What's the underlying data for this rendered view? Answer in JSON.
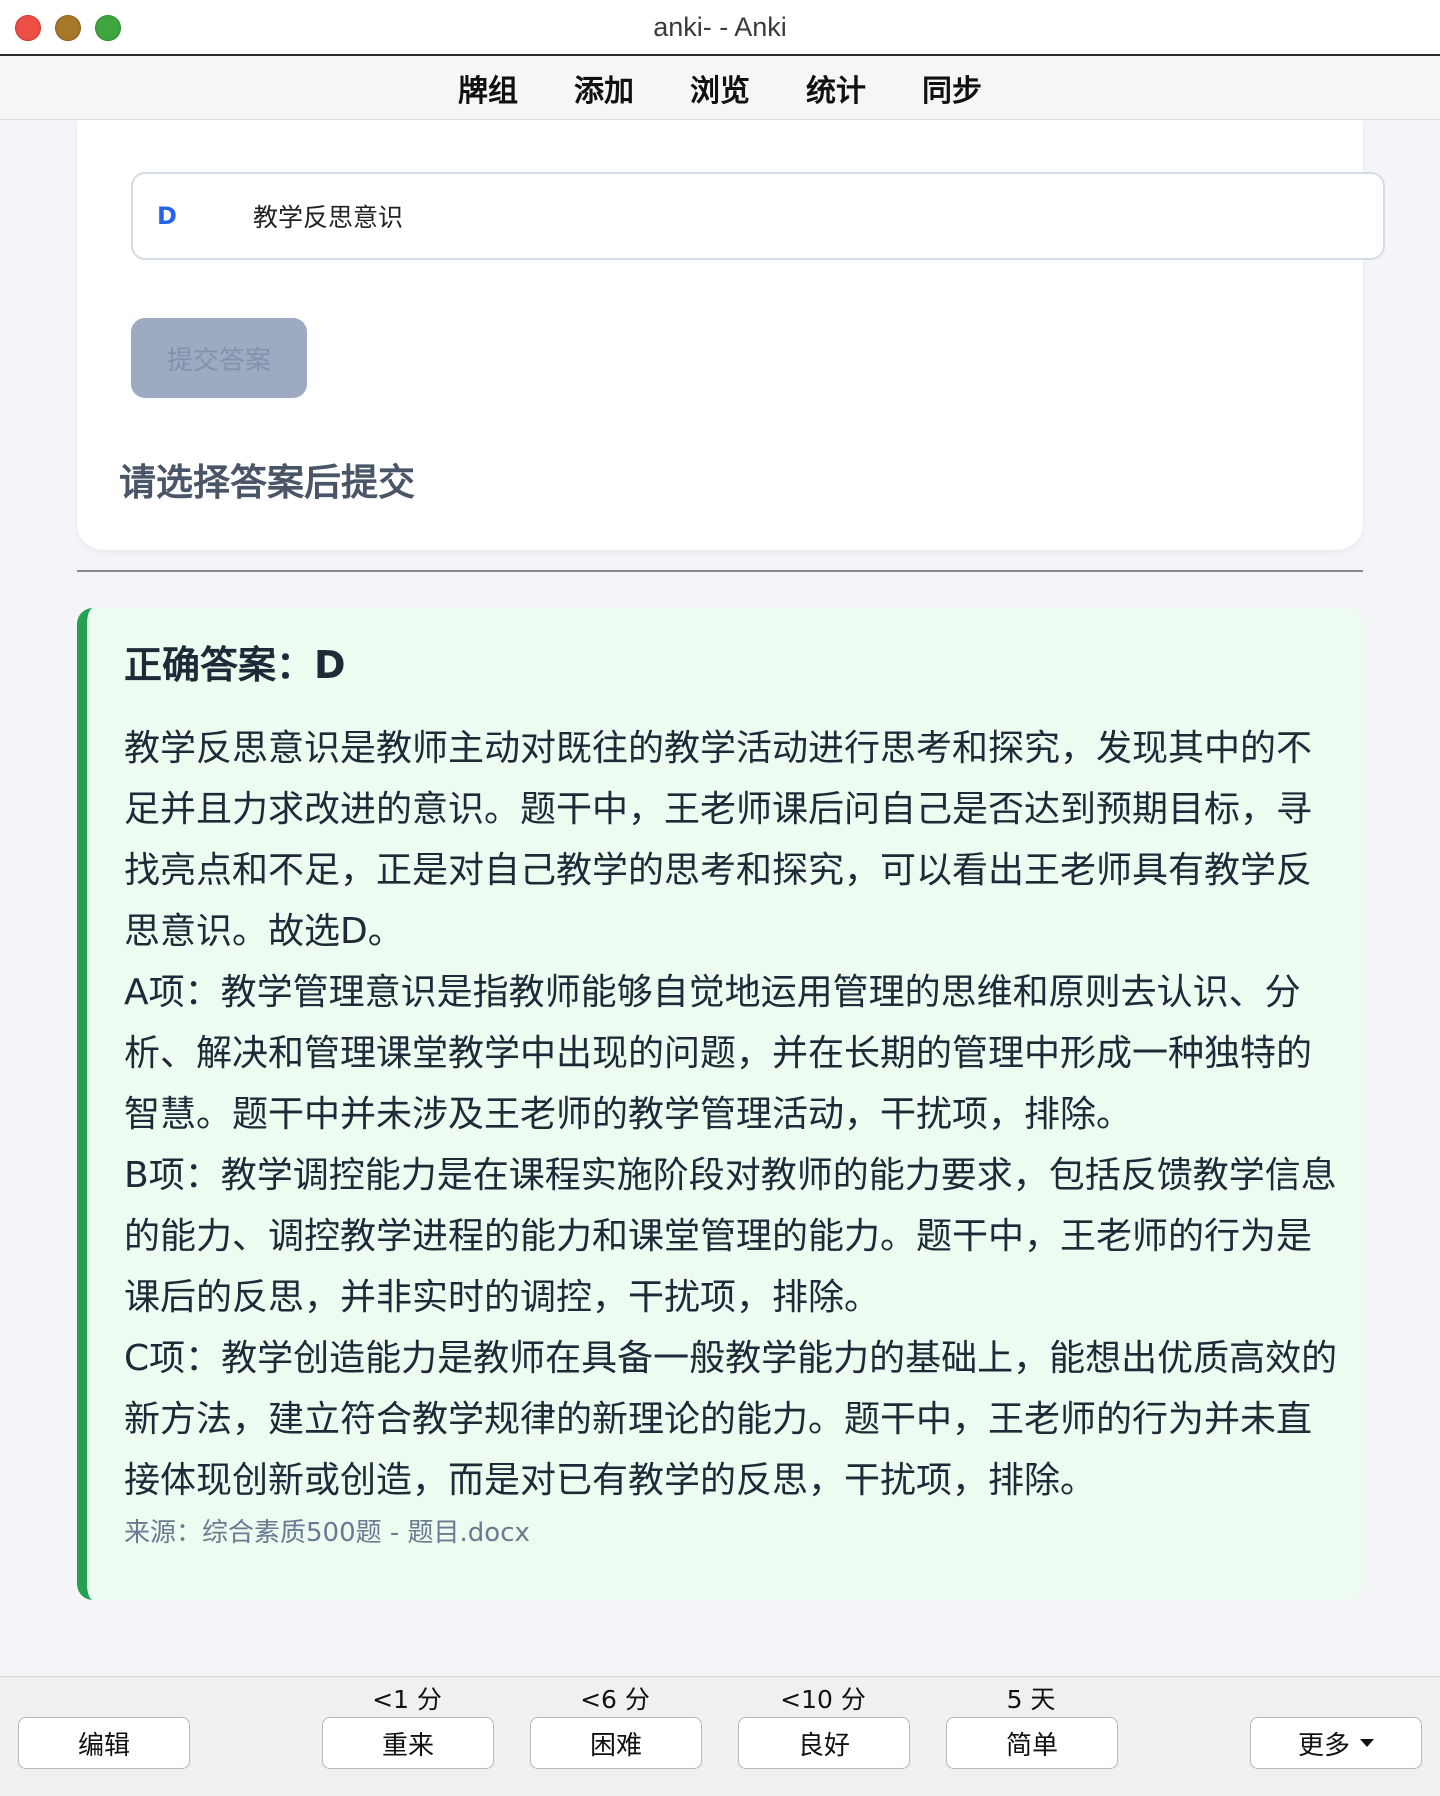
{
  "window": {
    "title": "anki- - Anki"
  },
  "menu": {
    "items": [
      "牌组",
      "添加",
      "浏览",
      "统计",
      "同步"
    ]
  },
  "question": {
    "option": {
      "letter": "D",
      "text": "教学反思意识"
    },
    "submit_label": "提交答案",
    "prompt": "请选择答案后提交"
  },
  "answer": {
    "title": "正确答案：D",
    "paragraphs": [
      "教学反思意识是教师主动对既往的教学活动进行思考和探究，发现其中的不足并且力求改进的意识。题干中，王老师课后问自己是否达到预期目标，寻找亮点和不足，正是对自己教学的思考和探究，可以看出王老师具有教学反思意识。故选D。",
      "A项：教学管理意识是指教师能够自觉地运用管理的思维和原则去认识、分析、解决和管理课堂教学中出现的问题，并在长期的管理中形成一种独特的智慧。题干中并未涉及王老师的教学管理活动，干扰项，排除。",
      "B项：教学调控能力是在课程实施阶段对教师的能力要求，包括反馈教学信息的能力、调控教学进程的能力和课堂管理的能力。题干中，王老师的行为是课后的反思，并非实时的调控，干扰项，排除。",
      "C项：教学创造能力是教师在具备一般教学能力的基础上，能想出优质高效的新方法，建立符合教学规律的新理论的能力。题干中，王老师的行为并未直接体现创新或创造，而是对已有教学的反思，干扰项，排除。"
    ],
    "source": "来源：综合素质500题 - 题目.docx"
  },
  "bottom": {
    "edit_label": "编辑",
    "more_label": "更多",
    "ease_buttons": [
      {
        "eta": "<1 分",
        "label": "重来"
      },
      {
        "eta": "<6 分",
        "label": "困难"
      },
      {
        "eta": "<10 分",
        "label": "良好"
      },
      {
        "eta": "5 天",
        "label": "简单"
      }
    ]
  },
  "colors": {
    "accent_blue": "#2563eb",
    "answer_border_green": "#22a24f",
    "answer_bg": "#edfbf1"
  },
  "icons": [
    "close-icon",
    "minimize-icon",
    "maximize-icon",
    "caret-down-icon"
  ]
}
